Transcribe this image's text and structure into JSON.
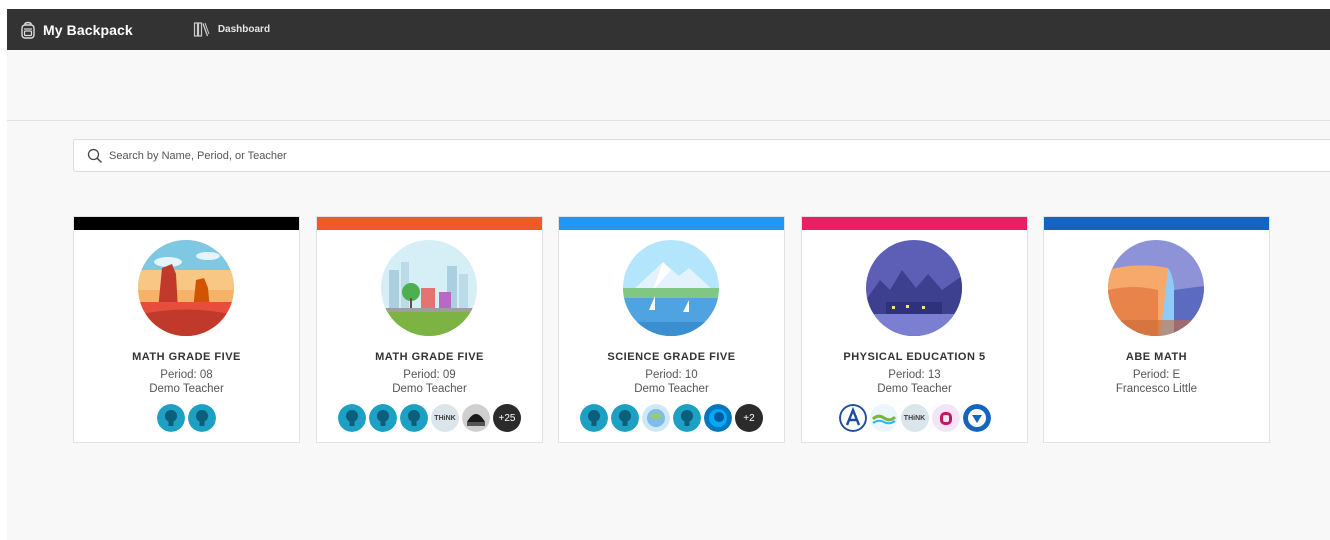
{
  "header": {
    "brand": "My Backpack",
    "nav_dashboard": "Dashboard"
  },
  "search": {
    "placeholder": "Search by Name, Period, or Teacher"
  },
  "colors": {
    "topbar": "#333333",
    "card1": "#000000",
    "card2": "#f05a28",
    "card3": "#2196f3",
    "card4": "#e91e63",
    "card5": "#1565c0"
  },
  "classes": [
    {
      "title": "MATH GRADE FIVE",
      "period": "Period: 08",
      "teacher": "Demo Teacher",
      "art": "desert-canyon-art",
      "apps": [
        "lightbulb-app-icon",
        "lightbulb-app-icon"
      ]
    },
    {
      "title": "MATH GRADE FIVE",
      "period": "Period: 09",
      "teacher": "Demo Teacher",
      "art": "city-park-art",
      "apps": [
        "lightbulb-app-icon",
        "lightbulb-app-icon",
        "lightbulb-app-icon",
        "think-app-icon",
        "dome-app-icon"
      ],
      "more": "+25",
      "think_label": "THiNK"
    },
    {
      "title": "SCIENCE GRADE FIVE",
      "period": "Period: 10",
      "teacher": "Demo Teacher",
      "art": "mountain-lake-art",
      "apps": [
        "lightbulb-app-icon",
        "lightbulb-app-icon",
        "globe-app-icon",
        "lightbulb-app-icon",
        "swirl-app-icon"
      ],
      "more": "+2"
    },
    {
      "title": "PHYSICAL EDUCATION 5",
      "period": "Period: 13",
      "teacher": "Demo Teacher",
      "art": "night-town-art",
      "apps": [
        "a-logo-app-icon",
        "wave-app-icon",
        "think-app-icon",
        "q-app-icon",
        "shield-app-icon"
      ],
      "think_label": "THiNK"
    },
    {
      "title": "ABE MATH",
      "period": "Period: E",
      "teacher": "Francesco Little",
      "art": "waterfall-cliff-art",
      "apps": []
    }
  ]
}
